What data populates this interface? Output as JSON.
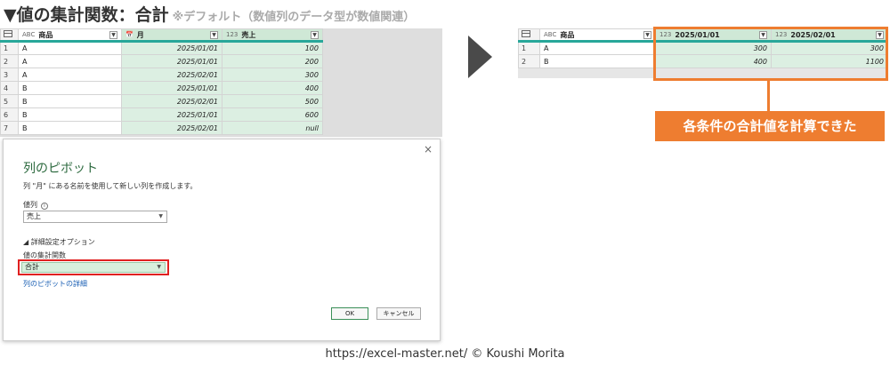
{
  "heading": {
    "main": "▼値の集計関数：合計",
    "note": "※デフォルト（数値列のデータ型が数値関連）"
  },
  "left_table": {
    "columns": [
      {
        "type_icon": "ABC",
        "name": "商品"
      },
      {
        "type_icon": "📅",
        "name": "月"
      },
      {
        "type_icon": "123",
        "name": "売上"
      }
    ],
    "rows": [
      {
        "n": "1",
        "item": "A",
        "month": "2025/01/01",
        "sales": "100"
      },
      {
        "n": "2",
        "item": "A",
        "month": "2025/01/01",
        "sales": "200"
      },
      {
        "n": "3",
        "item": "A",
        "month": "2025/02/01",
        "sales": "300"
      },
      {
        "n": "4",
        "item": "B",
        "month": "2025/01/01",
        "sales": "400"
      },
      {
        "n": "5",
        "item": "B",
        "month": "2025/02/01",
        "sales": "500"
      },
      {
        "n": "6",
        "item": "B",
        "month": "2025/01/01",
        "sales": "600"
      },
      {
        "n": "7",
        "item": "B",
        "month": "2025/02/01",
        "sales": "null"
      }
    ]
  },
  "dialog": {
    "close": "×",
    "title": "列のピボット",
    "description": "列 \"月\" にある名前を使用して新しい列を作成します。",
    "values_label": "値列",
    "info": "i",
    "values_selected": "売上",
    "advanced": "◢ 詳細設定オプション",
    "agg_label": "値の集計関数",
    "agg_selected": "合計",
    "link": "列のピボットの詳細",
    "ok": "OK",
    "cancel": "キャンセル"
  },
  "right_table": {
    "columns": [
      {
        "type_icon": "ABC",
        "name": "商品"
      },
      {
        "type_icon": "123",
        "name": "2025/01/01"
      },
      {
        "type_icon": "123",
        "name": "2025/02/01"
      }
    ],
    "rows": [
      {
        "n": "1",
        "item": "A",
        "v1": "300",
        "v2": "300"
      },
      {
        "n": "2",
        "item": "B",
        "v1": "400",
        "v2": "1100"
      }
    ]
  },
  "callout": "各条件の合計値を計算できた",
  "footer": "https://excel-master.net/  © Koushi Morita",
  "colors": {
    "accent": "#ee7d30",
    "teal": "#28a79a",
    "highlight_red": "#e02020"
  }
}
